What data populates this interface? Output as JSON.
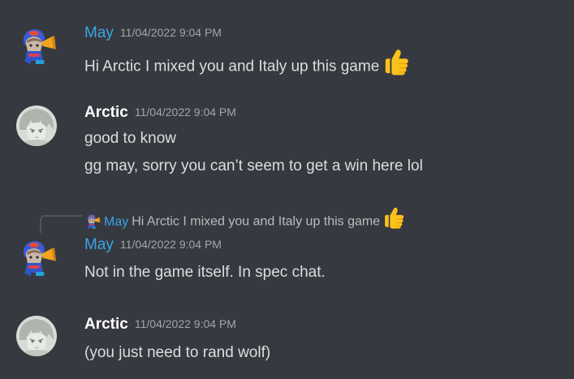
{
  "messages": [
    {
      "author": "May",
      "timestamp": "11/04/2022 9:04 PM",
      "lines": [
        "Hi Arctic I mixed you and Italy up this game"
      ],
      "emoji": "thumbs-up"
    },
    {
      "author": "Arctic",
      "timestamp": "11/04/2022 9:04 PM",
      "lines": [
        "good to know",
        "gg may, sorry you can’t seem to get a win here lol"
      ]
    },
    {
      "reply_to": {
        "author": "May",
        "text": "Hi Arctic I mixed you and Italy up this game",
        "emoji": "thumbs-up"
      },
      "author": "May",
      "timestamp": "11/04/2022 9:04 PM",
      "lines": [
        "Not in the game itself. In spec chat."
      ]
    },
    {
      "author": "Arctic",
      "timestamp": "11/04/2022 9:04 PM",
      "lines": [
        "(you just need to rand wolf)"
      ]
    }
  ],
  "colors": {
    "background": "#36393f",
    "may_name": "#3aa6e6",
    "arctic_name": "#ffffff",
    "timestamp": "#a3a6aa",
    "text": "#dcddde",
    "emoji_thumb": "#fcc21b"
  }
}
